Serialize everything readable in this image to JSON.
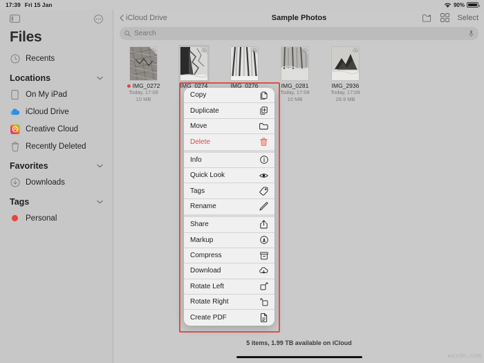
{
  "status_bar": {
    "time": "17:39",
    "date": "Fri 15 Jan",
    "wifi_icon": "wifi-icon",
    "battery_percent": "90%"
  },
  "sidebar": {
    "toggle_icon": "sidebar-toggle-icon",
    "more_icon": "more-ellipsis-icon",
    "title": "Files",
    "recents": {
      "label": "Recents",
      "icon": "clock-icon"
    },
    "sections": [
      {
        "title": "Locations",
        "chevron": "chevron-down-icon",
        "items": [
          {
            "label": "On My iPad",
            "icon": "ipad-icon"
          },
          {
            "label": "iCloud Drive",
            "icon": "icloud-icon"
          },
          {
            "label": "Creative Cloud",
            "icon": "creative-cloud-icon"
          },
          {
            "label": "Recently Deleted",
            "icon": "trash-icon"
          }
        ]
      },
      {
        "title": "Favorites",
        "chevron": "chevron-down-icon",
        "items": [
          {
            "label": "Downloads",
            "icon": "download-circle-icon"
          }
        ]
      },
      {
        "title": "Tags",
        "chevron": "chevron-down-icon",
        "items": [
          {
            "label": "Personal",
            "icon": "red-dot-icon",
            "color": "#e8453c"
          }
        ]
      }
    ]
  },
  "navbar": {
    "back_icon": "chevron-left-icon",
    "back_label": "iCloud Drive",
    "title": "Sample Photos",
    "new_folder_icon": "new-folder-icon",
    "grid_view_icon": "grid-view-icon",
    "select_label": "Select"
  },
  "search": {
    "icon": "search-icon",
    "placeholder": "Search",
    "mic_icon": "microphone-icon"
  },
  "files": [
    {
      "name": "IMG_0272",
      "date": "Today, 17:09",
      "size": "10 MB",
      "tag_color": "#e8453c",
      "selected": false
    },
    {
      "name": "IMG_0274",
      "date": "",
      "size": "",
      "tag_color": "",
      "selected": true
    },
    {
      "name": "IMG_0276",
      "date": "",
      "size": "",
      "tag_color": "",
      "selected": false
    },
    {
      "name": "IMG_0281",
      "date": "Today, 17:09",
      "size": "10 MB",
      "tag_color": "",
      "selected": false
    },
    {
      "name": "IMG_2936",
      "date": "Today, 17:09",
      "size": "28.9 MB",
      "tag_color": "",
      "selected": false
    }
  ],
  "context_menu": {
    "groups": [
      {
        "items": [
          {
            "label": "Copy",
            "icon": "copy-icon",
            "danger": false
          },
          {
            "label": "Duplicate",
            "icon": "duplicate-icon",
            "danger": false
          },
          {
            "label": "Move",
            "icon": "folder-icon",
            "danger": false
          },
          {
            "label": "Delete",
            "icon": "trash-icon",
            "danger": true
          }
        ]
      },
      {
        "items": [
          {
            "label": "Info",
            "icon": "info-circle-icon",
            "danger": false
          },
          {
            "label": "Quick Look",
            "icon": "eye-icon",
            "danger": false
          },
          {
            "label": "Tags",
            "icon": "tag-icon",
            "danger": false
          },
          {
            "label": "Rename",
            "icon": "pencil-icon",
            "danger": false
          }
        ]
      },
      {
        "items": [
          {
            "label": "Share",
            "icon": "share-icon",
            "danger": false
          },
          {
            "label": "Markup",
            "icon": "markup-icon",
            "danger": false
          },
          {
            "label": "Compress",
            "icon": "compress-icon",
            "danger": false
          },
          {
            "label": "Download",
            "icon": "cloud-download-icon",
            "danger": false
          },
          {
            "label": "Rotate Left",
            "icon": "rotate-left-icon",
            "danger": false
          },
          {
            "label": "Rotate Right",
            "icon": "rotate-right-icon",
            "danger": false
          },
          {
            "label": "Create PDF",
            "icon": "pdf-icon",
            "danger": false
          }
        ]
      }
    ]
  },
  "footer": {
    "status": "5 items, 1.99 TB available on iCloud"
  },
  "watermark": {
    "text": "wsxdn.com"
  }
}
